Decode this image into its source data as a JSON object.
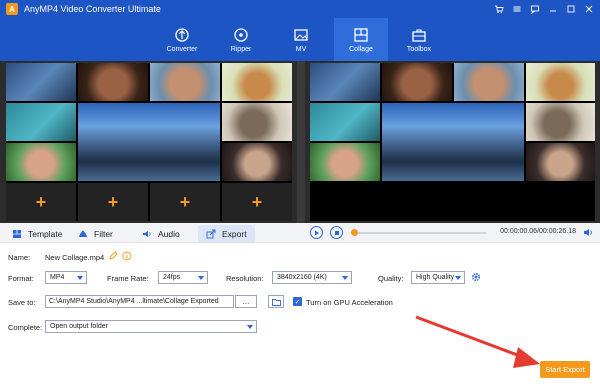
{
  "window": {
    "title": "AnyMP4 Video Converter Ultimate",
    "logo_glyph": "A"
  },
  "nav": {
    "items": [
      {
        "label": "Converter",
        "icon": "converter-icon"
      },
      {
        "label": "Ripper",
        "icon": "ripper-icon"
      },
      {
        "label": "MV",
        "icon": "mv-icon"
      },
      {
        "label": "Collage",
        "icon": "collage-icon",
        "active": true
      },
      {
        "label": "Toolbox",
        "icon": "toolbox-icon"
      }
    ]
  },
  "collage": {
    "add_glyph": "+"
  },
  "tabs": [
    {
      "label": "Template",
      "icon": "template-icon"
    },
    {
      "label": "Filter",
      "icon": "filter-icon"
    },
    {
      "label": "Audio",
      "icon": "audio-icon"
    },
    {
      "label": "Export",
      "icon": "export-icon",
      "active": true
    }
  ],
  "player": {
    "time": "00:00:00.06/00:00:26.18"
  },
  "export": {
    "name_label": "Name:",
    "name_value": "New Collage.mp4",
    "format_label": "Format:",
    "format_value": "MP4",
    "frame_rate_label": "Frame Rate:",
    "frame_rate_value": "24fps",
    "resolution_label": "Resolution:",
    "resolution_value": "3840x2160 (4K)",
    "quality_label": "Quality:",
    "quality_value": "High Quality",
    "save_to_label": "Save to:",
    "save_to_value": "C:\\AnyMP4 Studio\\AnyMP4 ...ltimate\\Collage Exported",
    "browse_label": "...",
    "gpu_label": "Turn on GPU Acceleration",
    "complete_label": "Complete:",
    "complete_value": "Open output folder",
    "start_label": "Start Export"
  },
  "colors": {
    "brand_blue": "#1d55c4",
    "accent_orange": "#f39a1e"
  }
}
